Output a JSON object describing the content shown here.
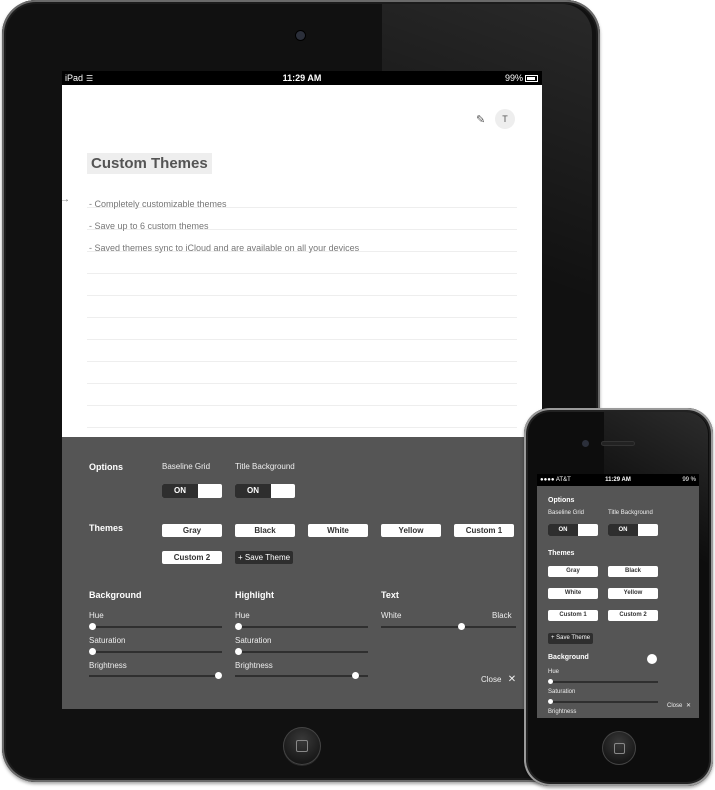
{
  "ipad": {
    "status": {
      "carrier": "iPad",
      "time": "11:29 AM",
      "battery": "99%"
    },
    "doc": {
      "title": "Custom Themes",
      "avatar": "T",
      "bullets": [
        "- Completely customizable themes",
        "- Save up to 6 custom themes",
        "- Saved themes sync to iCloud and are available on all your devices"
      ]
    },
    "panel": {
      "options_label": "Options",
      "baseline_grid_label": "Baseline Grid",
      "baseline_grid_state": "ON",
      "title_background_label": "Title Background",
      "title_background_state": "ON",
      "themes_label": "Themes",
      "themes": [
        "Gray",
        "Black",
        "White",
        "Yellow",
        "Custom 1",
        "Custom 2"
      ],
      "save_theme": "+ Save Theme",
      "background": {
        "label": "Background",
        "hue_label": "Hue",
        "hue": 0.0,
        "saturation_label": "Saturation",
        "saturation": 0.0,
        "brightness_label": "Brightness",
        "brightness": 1.0
      },
      "highlight": {
        "label": "Highlight",
        "hue_label": "Hue",
        "hue": 0.0,
        "saturation_label": "Saturation",
        "saturation": 0.0,
        "brightness_label": "Brightness",
        "brightness": 0.93
      },
      "text": {
        "label": "Text",
        "min_label": "White",
        "max_label": "Black",
        "value": 0.6
      },
      "close": "Close"
    }
  },
  "iphone": {
    "status": {
      "carrier": "AT&T",
      "time": "11:29 AM",
      "battery": "99 %"
    },
    "panel": {
      "options_label": "Options",
      "baseline_grid_label": "Baseline Grid",
      "baseline_grid_state": "ON",
      "title_background_label": "Title Background",
      "title_background_state": "ON",
      "themes_label": "Themes",
      "themes": [
        "Gray",
        "Black",
        "White",
        "Yellow",
        "Custom 1",
        "Custom 2"
      ],
      "save_theme": "+ Save Theme",
      "background_label": "Background",
      "hue_label": "Hue",
      "saturation_label": "Saturation",
      "brightness_label": "Brightness",
      "close": "Close"
    }
  },
  "icons": {
    "pencil": "pencil-icon",
    "close": "close-icon",
    "wifi": "wifi-icon",
    "battery": "battery-icon",
    "margin_arrow": "arrow-right-icon"
  }
}
